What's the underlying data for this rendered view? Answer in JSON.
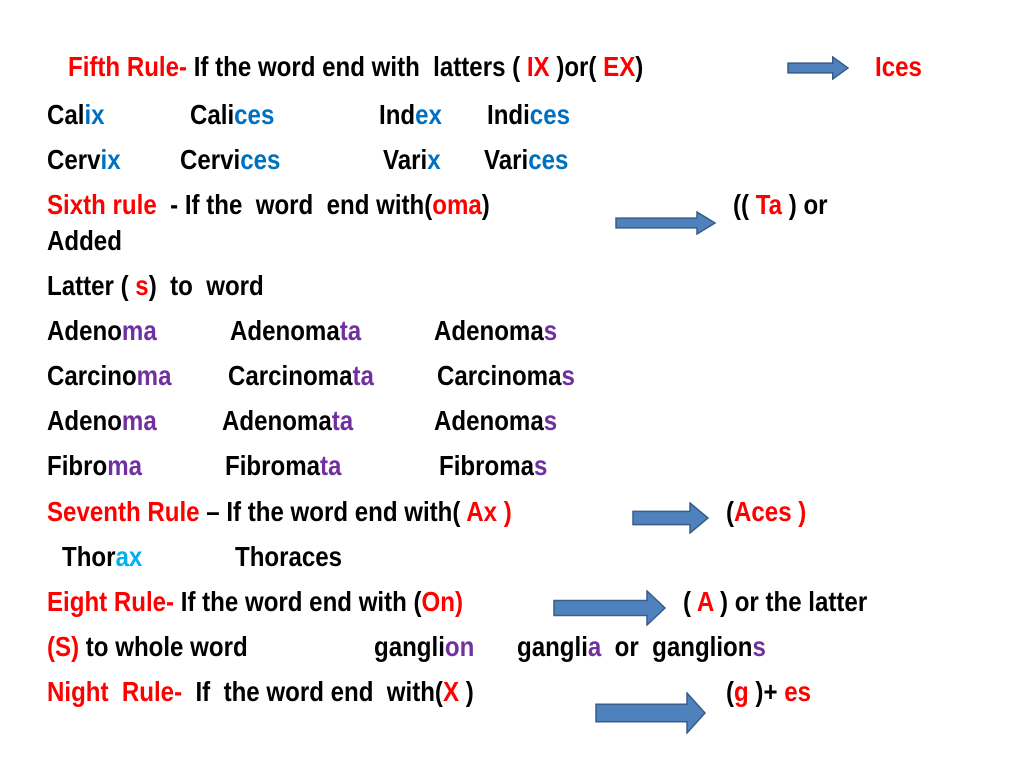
{
  "colors": {
    "red": "#ff0000",
    "blue": "#0070c0",
    "purple": "#7030a0",
    "cyan": "#00b0f0",
    "black": "#000000",
    "arrow_fill": "#4f81bd",
    "arrow_stroke": "#385d8a"
  },
  "lines": [
    {
      "name": "fifth-rule",
      "cells": [
        [
          {
            "t": "Fifth Rule-",
            "c": "red"
          },
          {
            "t": " If the word end with  latters ( ",
            "c": "black"
          },
          {
            "t": "IX",
            "c": "red"
          },
          {
            "t": " )or( ",
            "c": "black"
          },
          {
            "t": "EX",
            "c": "red"
          },
          {
            "t": ")",
            "c": "black"
          }
        ],
        [
          {
            "t": "Ices",
            "c": "red"
          }
        ]
      ]
    },
    {
      "name": "example-calix",
      "cells": [
        [
          {
            "t": "Cal",
            "c": "black"
          },
          {
            "t": "ix",
            "c": "blue"
          }
        ],
        [
          {
            "t": "Cali",
            "c": "black"
          },
          {
            "t": "ces",
            "c": "blue"
          }
        ],
        [
          {
            "t": "Ind",
            "c": "black"
          },
          {
            "t": "ex",
            "c": "blue"
          }
        ],
        [
          {
            "t": "Indi",
            "c": "black"
          },
          {
            "t": "ces",
            "c": "blue"
          }
        ]
      ]
    },
    {
      "name": "example-cervix",
      "cells": [
        [
          {
            "t": "Cerv",
            "c": "black"
          },
          {
            "t": "ix",
            "c": "blue"
          }
        ],
        [
          {
            "t": "Cervi",
            "c": "black"
          },
          {
            "t": "ces",
            "c": "blue"
          }
        ],
        [
          {
            "t": "Vari",
            "c": "black"
          },
          {
            "t": "x",
            "c": "blue"
          }
        ],
        [
          {
            "t": "Vari",
            "c": "black"
          },
          {
            "t": "ces",
            "c": "blue"
          }
        ]
      ]
    },
    {
      "name": "sixth-rule",
      "cells": [
        [
          {
            "t": "Sixth rule",
            "c": "red"
          },
          {
            "t": "  - If the  word  end with(",
            "c": "black"
          },
          {
            "t": "oma",
            "c": "red"
          },
          {
            "t": ")",
            "c": "black"
          }
        ],
        [
          {
            "t": "(( ",
            "c": "black"
          },
          {
            "t": "Ta",
            "c": "red"
          },
          {
            "t": " ) or",
            "c": "black"
          }
        ]
      ]
    },
    {
      "name": "sixth-rule-cont-1",
      "cells": [
        [
          {
            "t": "Added",
            "c": "black"
          }
        ]
      ]
    },
    {
      "name": "sixth-rule-cont-2",
      "cells": [
        [
          {
            "t": "Latter ( ",
            "c": "black"
          },
          {
            "t": "s",
            "c": "red"
          },
          {
            "t": ")  to  word",
            "c": "black"
          }
        ]
      ]
    },
    {
      "name": "example-adenoma",
      "cells": [
        [
          {
            "t": "Adeno",
            "c": "black"
          },
          {
            "t": "ma",
            "c": "purple"
          }
        ],
        [
          {
            "t": "Adenoma",
            "c": "black"
          },
          {
            "t": "ta",
            "c": "purple"
          }
        ],
        [
          {
            "t": "Adenoma",
            "c": "black"
          },
          {
            "t": "s",
            "c": "purple"
          }
        ]
      ]
    },
    {
      "name": "example-carcinoma",
      "cells": [
        [
          {
            "t": "Carcino",
            "c": "black"
          },
          {
            "t": "ma",
            "c": "purple"
          }
        ],
        [
          {
            "t": "Carcinoma",
            "c": "black"
          },
          {
            "t": "ta",
            "c": "purple"
          }
        ],
        [
          {
            "t": "Carcinoma",
            "c": "black"
          },
          {
            "t": "s",
            "c": "purple"
          }
        ]
      ]
    },
    {
      "name": "example-adenoma-2",
      "cells": [
        [
          {
            "t": "Adeno",
            "c": "black"
          },
          {
            "t": "ma",
            "c": "purple"
          }
        ],
        [
          {
            "t": "Adenoma",
            "c": "black"
          },
          {
            "t": "ta",
            "c": "purple"
          }
        ],
        [
          {
            "t": "Adenoma",
            "c": "black"
          },
          {
            "t": "s",
            "c": "purple"
          }
        ]
      ]
    },
    {
      "name": "example-fibroma",
      "cells": [
        [
          {
            "t": "Fibro",
            "c": "black"
          },
          {
            "t": "ma",
            "c": "purple"
          }
        ],
        [
          {
            "t": "Fibroma",
            "c": "black"
          },
          {
            "t": "ta",
            "c": "purple"
          }
        ],
        [
          {
            "t": "Fibroma",
            "c": "black"
          },
          {
            "t": "s",
            "c": "purple"
          }
        ]
      ]
    },
    {
      "name": "seventh-rule",
      "cells": [
        [
          {
            "t": "Seventh Rule",
            "c": "red"
          },
          {
            "t": " – If the word end with( ",
            "c": "black"
          },
          {
            "t": "Ax )",
            "c": "red"
          }
        ],
        [
          {
            "t": "(",
            "c": "black"
          },
          {
            "t": "Aces )",
            "c": "red"
          }
        ]
      ]
    },
    {
      "name": "example-thorax",
      "cells": [
        [
          {
            "t": "Thor",
            "c": "black"
          },
          {
            "t": "ax",
            "c": "cyan"
          }
        ],
        [
          {
            "t": "Thoraces",
            "c": "black"
          }
        ]
      ]
    },
    {
      "name": "eighth-rule",
      "cells": [
        [
          {
            "t": "Eight Rule-",
            "c": "red"
          },
          {
            "t": " If the word end with (",
            "c": "black"
          },
          {
            "t": "On)",
            "c": "red"
          }
        ],
        [
          {
            "t": "( ",
            "c": "black"
          },
          {
            "t": "A",
            "c": "red"
          },
          {
            "t": " ) or the latter",
            "c": "black"
          }
        ]
      ]
    },
    {
      "name": "eighth-rule-cont",
      "cells": [
        [
          {
            "t": "(S)",
            "c": "red"
          },
          {
            "t": " to whole word",
            "c": "black"
          }
        ],
        [
          {
            "t": "gangli",
            "c": "black"
          },
          {
            "t": "on",
            "c": "purple"
          }
        ],
        [
          {
            "t": "gangli",
            "c": "black"
          },
          {
            "t": "a",
            "c": "purple"
          },
          {
            "t": "  or  ganglion",
            "c": "black"
          },
          {
            "t": "s",
            "c": "purple"
          }
        ]
      ]
    },
    {
      "name": "ninth-rule",
      "cells": [
        [
          {
            "t": "Night  Rule-",
            "c": "red"
          },
          {
            "t": "  If  the word end  with(",
            "c": "black"
          },
          {
            "t": "X",
            "c": "red"
          },
          {
            "t": " )",
            "c": "black"
          }
        ],
        [
          {
            "t": "(",
            "c": "black"
          },
          {
            "t": "g",
            "c": "red"
          },
          {
            "t": " )+ ",
            "c": "black"
          },
          {
            "t": "es",
            "c": "red"
          }
        ]
      ]
    }
  ]
}
